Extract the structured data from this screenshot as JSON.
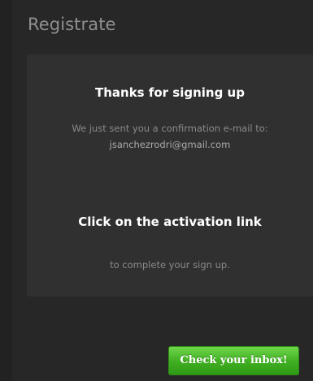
{
  "header": {
    "title": "Registrate"
  },
  "card": {
    "heading": "Thanks for signing up",
    "sent_text": "We just sent you a confirmation e-mail to:",
    "email": "jsanchezrodri@gmail.com",
    "activation_heading": "Click on the activation link",
    "complete_text": "to complete your sign up."
  },
  "actions": {
    "check_inbox_label": "Check your inbox!"
  },
  "colors": {
    "background": "#222222",
    "card": "#303030",
    "accent_green": "#3fae21"
  }
}
